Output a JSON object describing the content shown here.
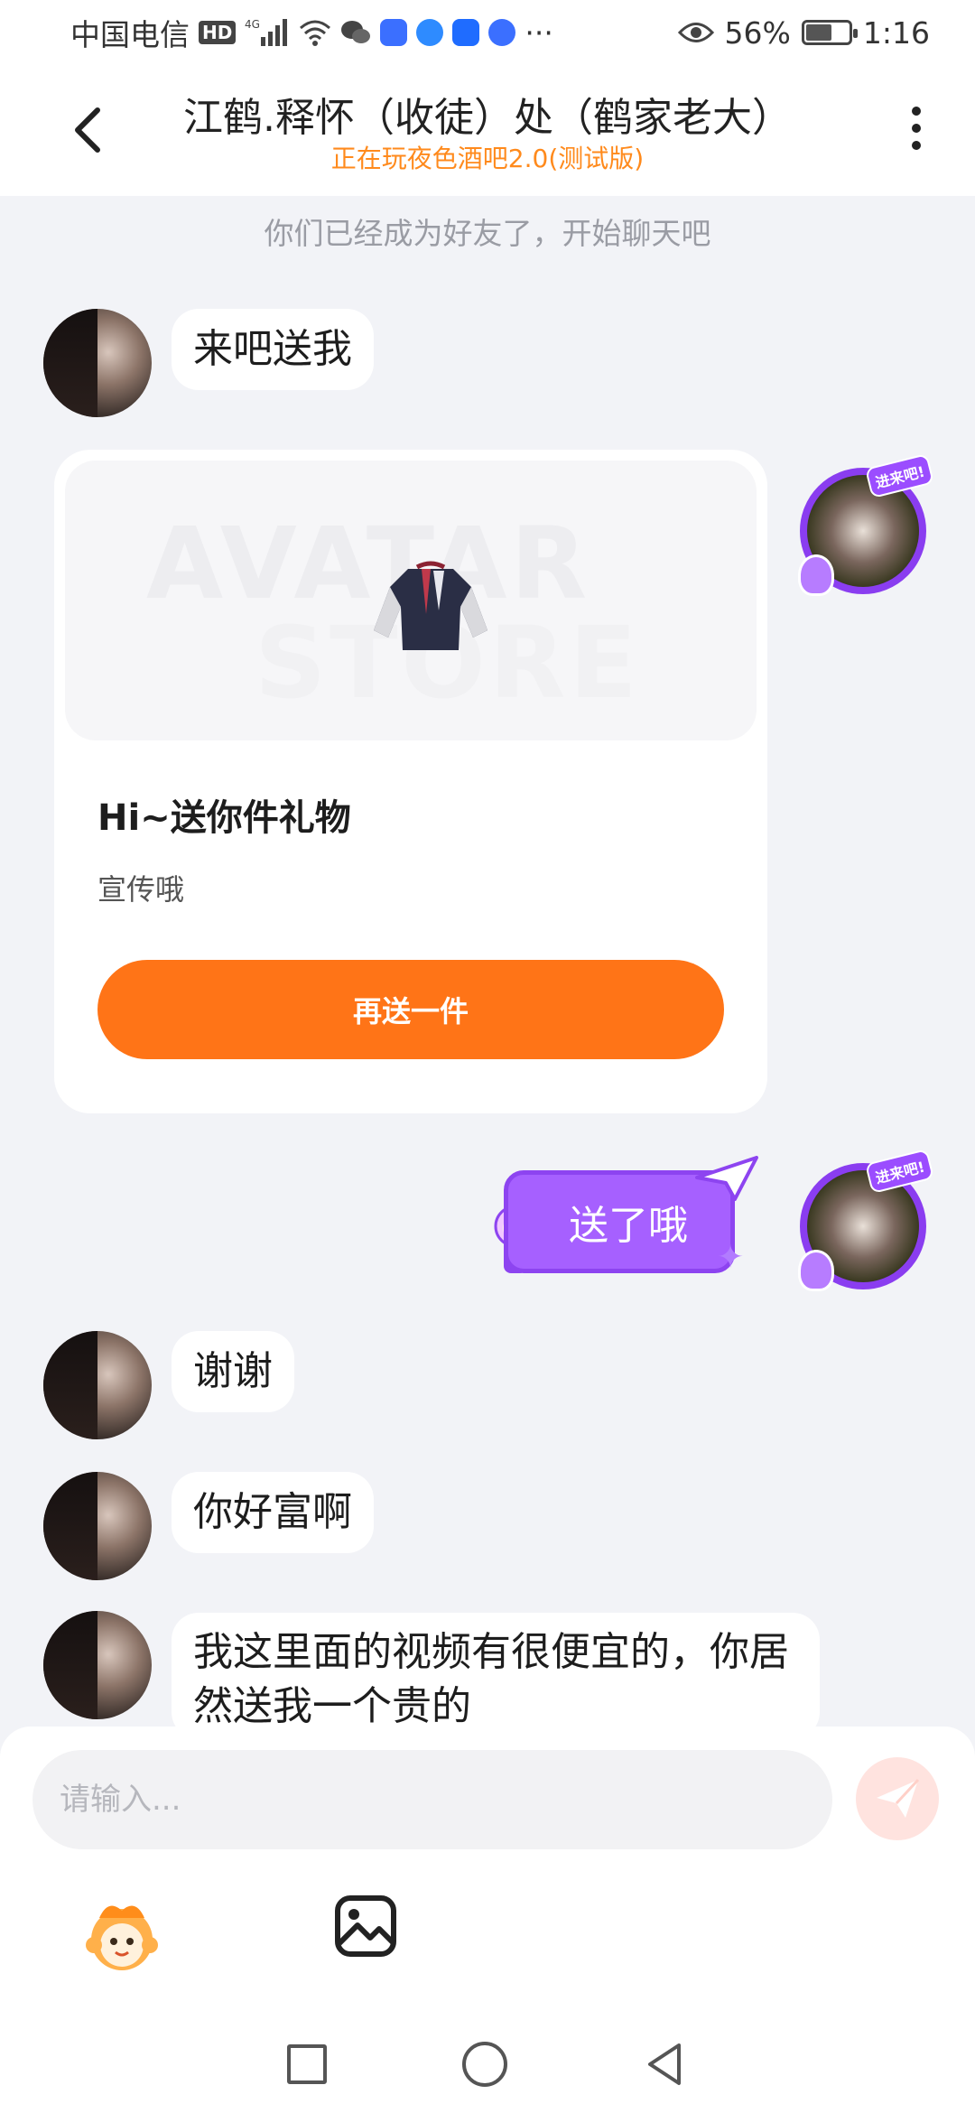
{
  "status_bar": {
    "carrier": "中国电信",
    "hd": "HD",
    "network": "4G",
    "battery_percent": "56%",
    "time": "1:16",
    "more": "···"
  },
  "header": {
    "title": "江鹤.释怀（收徒）处（鹤家老大）",
    "subtitle": "正在玩夜色酒吧2.0(测试版)"
  },
  "chat": {
    "system_note": "你们已经成为好友了，开始聊天吧",
    "messages": {
      "m1": "来吧送我",
      "m2": "送了哦",
      "m3": "谢谢",
      "m4": "你好富啊",
      "m5": "我这里面的视频有很便宜的，你居然送我一个贵的"
    },
    "gift_card": {
      "watermark_line1": "AVATAR",
      "watermark_line2": "STORE",
      "title": "Hi~送你件礼物",
      "description": "宣传哦",
      "button_label": "再送一件"
    },
    "self_badge": "进来吧!"
  },
  "input": {
    "placeholder": "请输入..."
  },
  "colors": {
    "accent_orange": "#ff7417",
    "subtitle_orange": "#ff8a1c",
    "bubble_purple": "#a660ff",
    "background": "#f2f3f7"
  }
}
